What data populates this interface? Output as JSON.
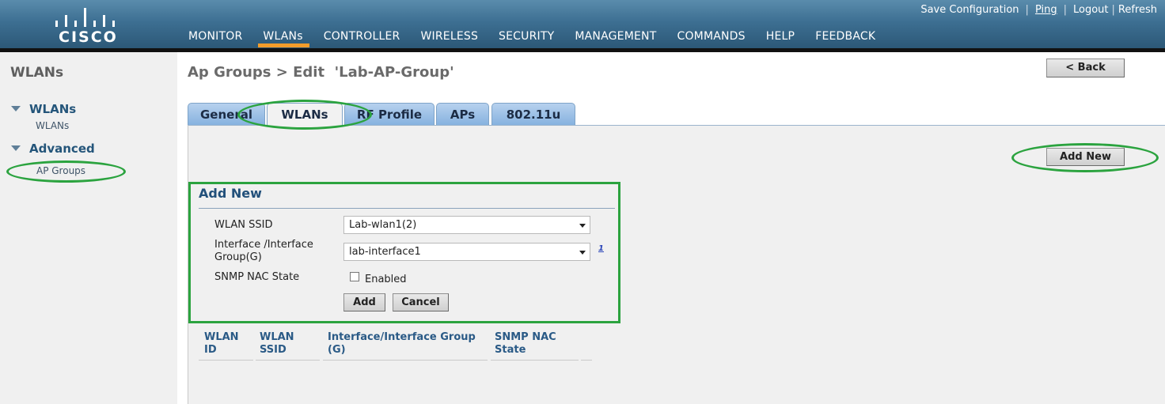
{
  "header": {
    "logo_text": "CISCO",
    "top_links": [
      "Save Configuration",
      "Ping",
      "Logout",
      "Refresh"
    ],
    "nav": [
      {
        "label": "MONITOR",
        "active": false
      },
      {
        "label": "WLANs",
        "active": true
      },
      {
        "label": "CONTROLLER",
        "active": false
      },
      {
        "label": "WIRELESS",
        "active": false
      },
      {
        "label": "SECURITY",
        "active": false
      },
      {
        "label": "MANAGEMENT",
        "active": false
      },
      {
        "label": "COMMANDS",
        "active": false
      },
      {
        "label": "HELP",
        "active": false
      },
      {
        "label": "FEEDBACK",
        "active": false
      }
    ],
    "accent_color": "#f29c2b"
  },
  "sidebar": {
    "title": "WLANs",
    "sections": [
      {
        "label": "WLANs",
        "items": [
          "WLANs"
        ]
      },
      {
        "label": "Advanced",
        "items": [
          "AP Groups"
        ]
      }
    ]
  },
  "main": {
    "page_title": "Ap Groups > Edit  'Lab-AP-Group'",
    "back_button": "< Back",
    "tabs": [
      {
        "label": "General",
        "active": false
      },
      {
        "label": "WLANs",
        "active": true
      },
      {
        "label": "RF Profile",
        "active": false
      },
      {
        "label": "APs",
        "active": false
      },
      {
        "label": "802.11u",
        "active": false
      }
    ],
    "add_new_button": "Add New",
    "form": {
      "title": "Add New",
      "wlan_ssid_label": "WLAN SSID",
      "wlan_ssid_value": "Lab-wlan1(2)",
      "interface_label": "Interface /Interface Group(G)",
      "interface_value": "lab-interface1",
      "help_link": "1",
      "snmp_label": "SNMP NAC State",
      "snmp_checkbox_label": "Enabled",
      "snmp_checked": false,
      "add_button": "Add",
      "cancel_button": "Cancel"
    },
    "table": {
      "headers": [
        "WLAN ID",
        "WLAN SSID",
        "Interface/Interface Group (G)",
        "SNMP NAC State"
      ],
      "rows": []
    }
  },
  "annotation_color": "#2ba33f"
}
